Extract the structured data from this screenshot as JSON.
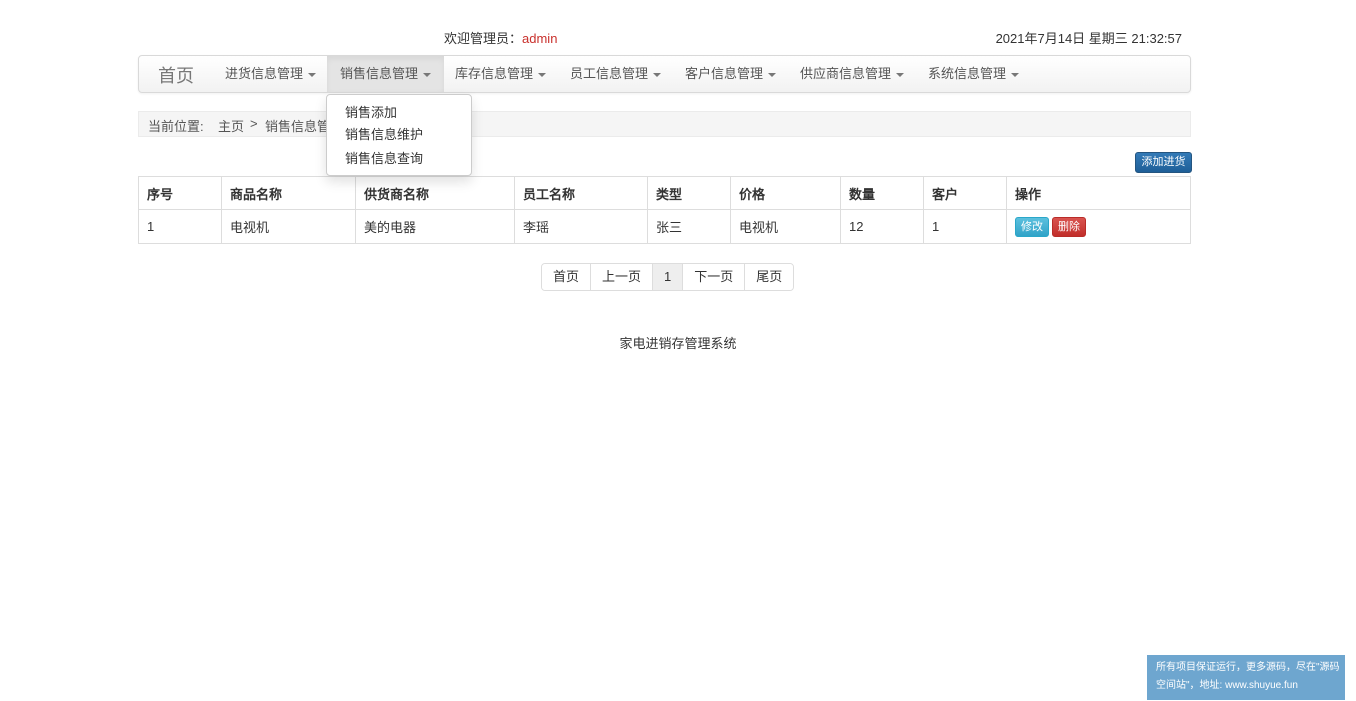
{
  "header": {
    "welcome_prefix": "欢迎管理员：",
    "username": "admin",
    "datetime": "2021年7月14日 星期三 21:32:57"
  },
  "nav": {
    "brand": "首页",
    "items": [
      {
        "label": "进货信息管理"
      },
      {
        "label": "销售信息管理"
      },
      {
        "label": "库存信息管理"
      },
      {
        "label": "员工信息管理"
      },
      {
        "label": "客户信息管理"
      },
      {
        "label": "供应商信息管理"
      },
      {
        "label": "系统信息管理"
      }
    ],
    "active_index": 1
  },
  "dropdown": {
    "items": [
      {
        "label": "销售添加"
      },
      {
        "label": "销售信息维护"
      },
      {
        "label": "销售信息查询"
      }
    ]
  },
  "breadcrumb": {
    "prefix": "当前位置:",
    "home": "主页",
    "separator": ">",
    "current": "销售信息管"
  },
  "actions": {
    "add_label": "添加进货"
  },
  "table": {
    "headers": [
      "序号",
      "商品名称",
      "供货商名称",
      "员工名称",
      "类型",
      "价格",
      "数量",
      "客户",
      "操作"
    ],
    "rows": [
      {
        "cells": [
          "1",
          "电视机",
          "美的电器",
          "李瑶",
          "张三",
          "电视机",
          "12",
          "1"
        ],
        "edit_label": "修改",
        "delete_label": "删除"
      }
    ]
  },
  "pagination": {
    "first": "首页",
    "prev": "上一页",
    "current": "1",
    "next": "下一页",
    "last": "尾页"
  },
  "footer": {
    "text": "家电进销存管理系统"
  },
  "ad": {
    "line1": "所有项目保证运行，更多源码，尽在\"源码",
    "line2": "空间站\"，地址: www.shuyue.fun"
  },
  "colors": {
    "username": "#c9302c",
    "primary_button": "#337ab7",
    "info_button": "#5bc0de",
    "danger_button": "#d9534f",
    "ad_background": "#6ea6cf"
  }
}
